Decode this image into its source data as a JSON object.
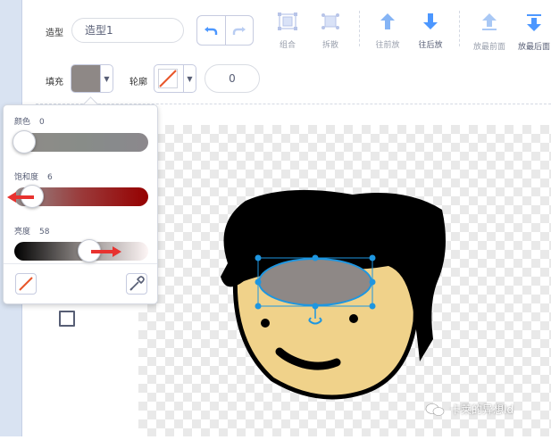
{
  "costume": {
    "label": "造型",
    "name": "造型1"
  },
  "fill": {
    "label": "填充",
    "color": "#8e8886"
  },
  "outline": {
    "label": "轮廓",
    "width": "0"
  },
  "tools": {
    "group": "组合",
    "ungroup": "拆散",
    "forward": "往前放",
    "backward": "往后放",
    "front": "放最前面",
    "back": "放最后面"
  },
  "picker": {
    "color_label": "颜色",
    "color_value": "0",
    "saturation_label": "饱和度",
    "saturation_value": "6",
    "brightness_label": "亮度",
    "brightness_value": "58"
  },
  "colors": {
    "accent": "#855cd6",
    "selection": "#1e96e0",
    "arrow_red": "#e8322f",
    "face": "#f0d28a",
    "hair": "#000000"
  },
  "watermark": "卡莱的异想Id"
}
